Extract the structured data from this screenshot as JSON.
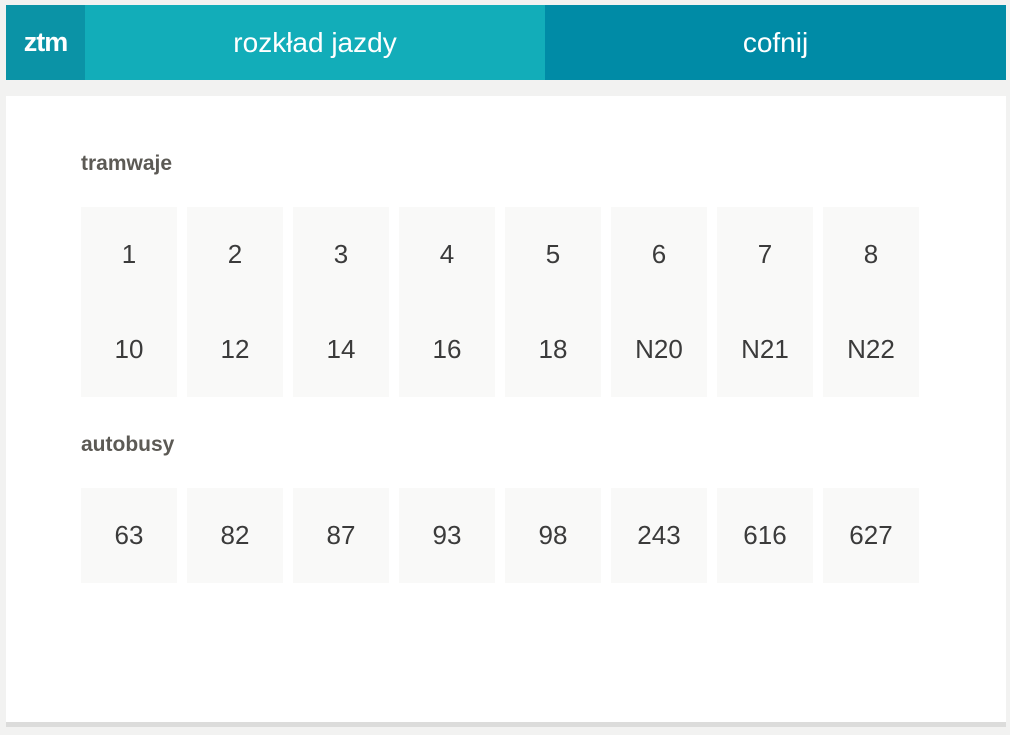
{
  "header": {
    "logo": "ztm",
    "schedule_label": "rozkład jazdy",
    "back_label": "cofnij"
  },
  "colors": {
    "logo_bg": "#0b93a6",
    "schedule_bg": "#12adb9",
    "back_bg": "#008ba6"
  },
  "sections": {
    "trams": {
      "title": "tramwaje",
      "lines": [
        "1",
        "2",
        "3",
        "4",
        "5",
        "6",
        "7",
        "8",
        "10",
        "12",
        "14",
        "16",
        "18",
        "N20",
        "N21",
        "N22"
      ]
    },
    "buses": {
      "title": "autobusy",
      "lines": [
        "63",
        "82",
        "87",
        "93",
        "98",
        "243",
        "616",
        "627"
      ]
    }
  }
}
